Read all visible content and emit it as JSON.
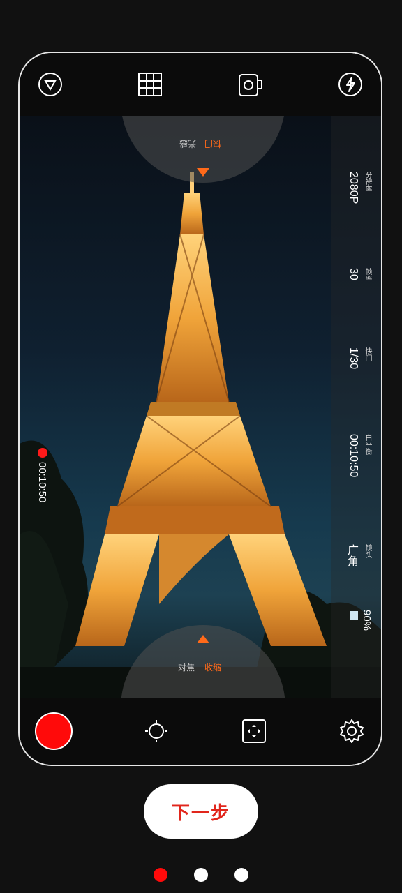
{
  "topbar": {
    "icons": [
      "filter-triangle-icon",
      "grid-icon",
      "camera-flip-icon",
      "flash-icon"
    ]
  },
  "dials": {
    "top": {
      "label_active": "快门",
      "label_other": "光感"
    },
    "bottom": {
      "label_other": "对焦",
      "label_active": "收缩"
    }
  },
  "params": [
    {
      "label": "分辨率",
      "value": "2080P"
    },
    {
      "label": "帧率",
      "value": "30"
    },
    {
      "label": "快门",
      "value": "1/30"
    },
    {
      "label": "白平衡",
      "value": "00:10:50"
    },
    {
      "label": "镜头",
      "value": "广角"
    }
  ],
  "battery": {
    "value": "90%"
  },
  "recording": {
    "time": "00:10:50"
  },
  "bottombar": {
    "icons": [
      "record-button",
      "brightness-icon",
      "focus-frame-icon",
      "settings-gear-icon"
    ]
  },
  "next_button": {
    "label": "下一步"
  },
  "pager": {
    "total": 3,
    "active_index": 0
  },
  "colors": {
    "accent": "#ff0a0a",
    "next_text": "#e1261c",
    "dial_active": "#ff6a1a"
  }
}
